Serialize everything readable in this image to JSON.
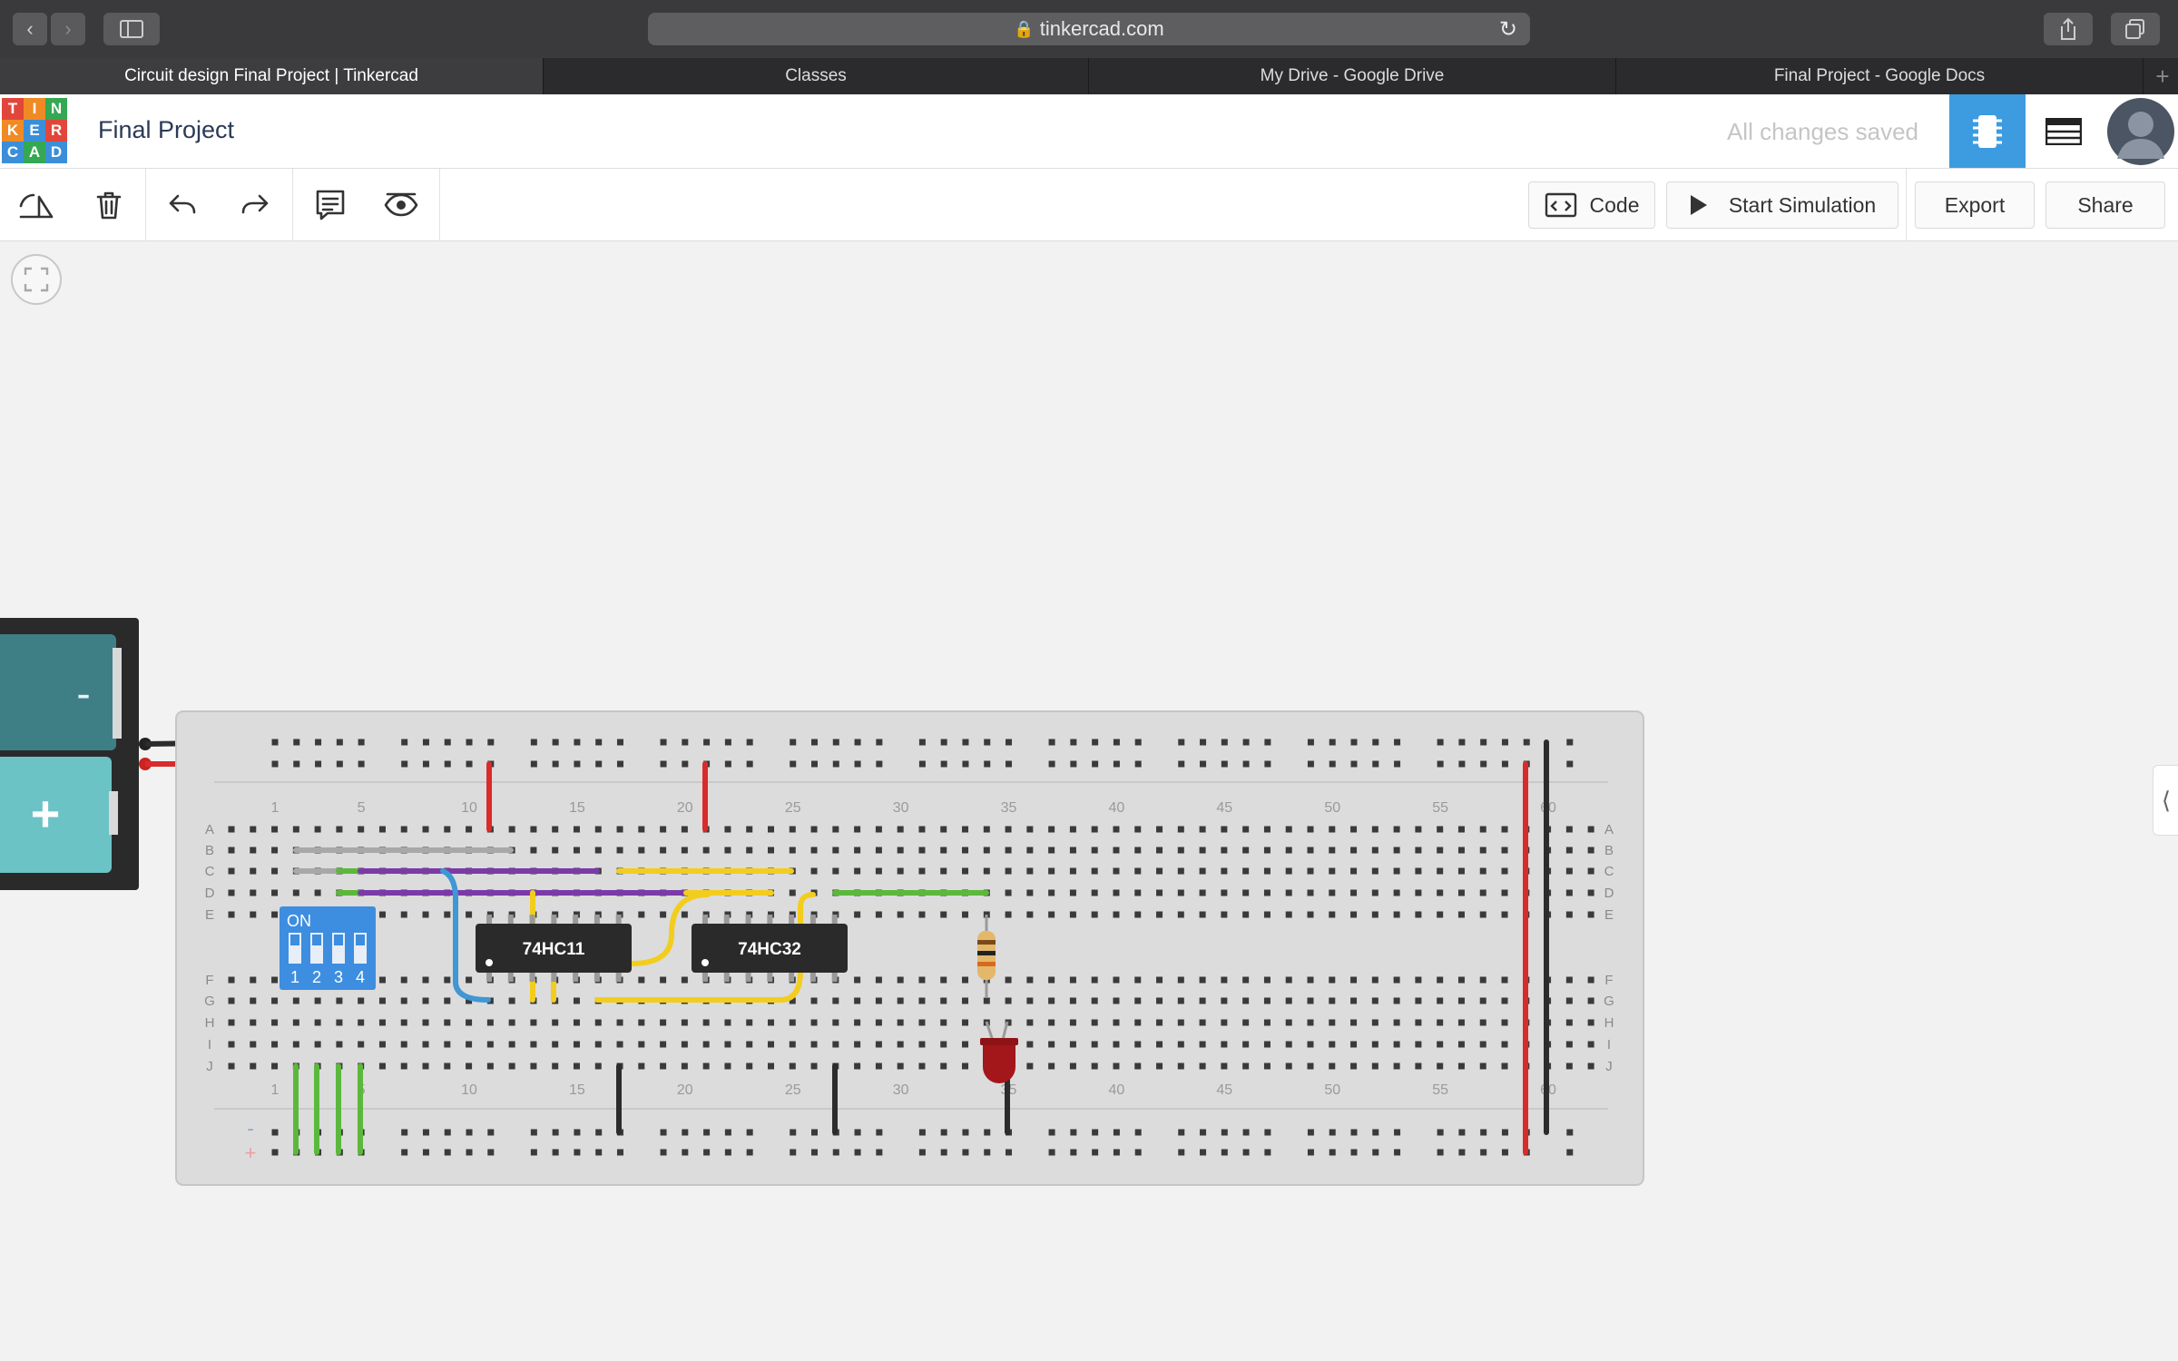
{
  "browser": {
    "url": "tinkercad.com",
    "tabs": [
      {
        "label": "Circuit design Final Project | Tinkercad",
        "active": true
      },
      {
        "label": "Classes",
        "active": false
      },
      {
        "label": "My Drive - Google Drive",
        "active": false
      },
      {
        "label": "Final Project - Google Docs",
        "active": false
      }
    ],
    "new_tab_label": "+"
  },
  "app": {
    "logo_letters": [
      "T",
      "I",
      "N",
      "K",
      "E",
      "R",
      "C",
      "A",
      "D"
    ],
    "logo_colors": [
      "#e2463a",
      "#f08a24",
      "#34a853",
      "#f08a24",
      "#3b8fd9",
      "#e2463a",
      "#3b8fd9",
      "#34a853",
      "#3b8fd9"
    ],
    "project_title": "Final Project",
    "save_status": "All changes saved",
    "accent_color": "#3d9ce0"
  },
  "toolbar": {
    "tools": [
      "rotate-icon",
      "trash-icon",
      "undo-icon",
      "redo-icon",
      "notes-icon",
      "visibility-icon"
    ],
    "code_label": "Code",
    "start_simulation_label": "Start Simulation",
    "export_label": "Export",
    "share_label": "Share"
  },
  "circuit": {
    "battery_minus_label": "-",
    "battery_plus_label": "+",
    "column_labels": [
      "1",
      "5",
      "10",
      "15",
      "20",
      "25",
      "30",
      "35",
      "40",
      "45",
      "50",
      "55",
      "60"
    ],
    "row_labels_top": [
      "A",
      "B",
      "C",
      "D",
      "E"
    ],
    "row_labels_bottom": [
      "F",
      "G",
      "H",
      "I",
      "J"
    ],
    "rail_labels": [
      "-",
      "+"
    ],
    "dip_switch": {
      "on_label": "ON",
      "numbers": [
        "1",
        "2",
        "3",
        "4"
      ]
    },
    "chips": [
      {
        "label": "74HC11"
      },
      {
        "label": "74HC32"
      }
    ],
    "components": [
      "resistor",
      "led"
    ],
    "wire_colors": {
      "red": "#d92b2b",
      "black": "#2c2c2c",
      "green": "#5cb83c",
      "purple": "#7b3aa8",
      "yellow": "#f2cd1e",
      "blue": "#3f97d4",
      "grey": "#a8a8a8"
    }
  }
}
